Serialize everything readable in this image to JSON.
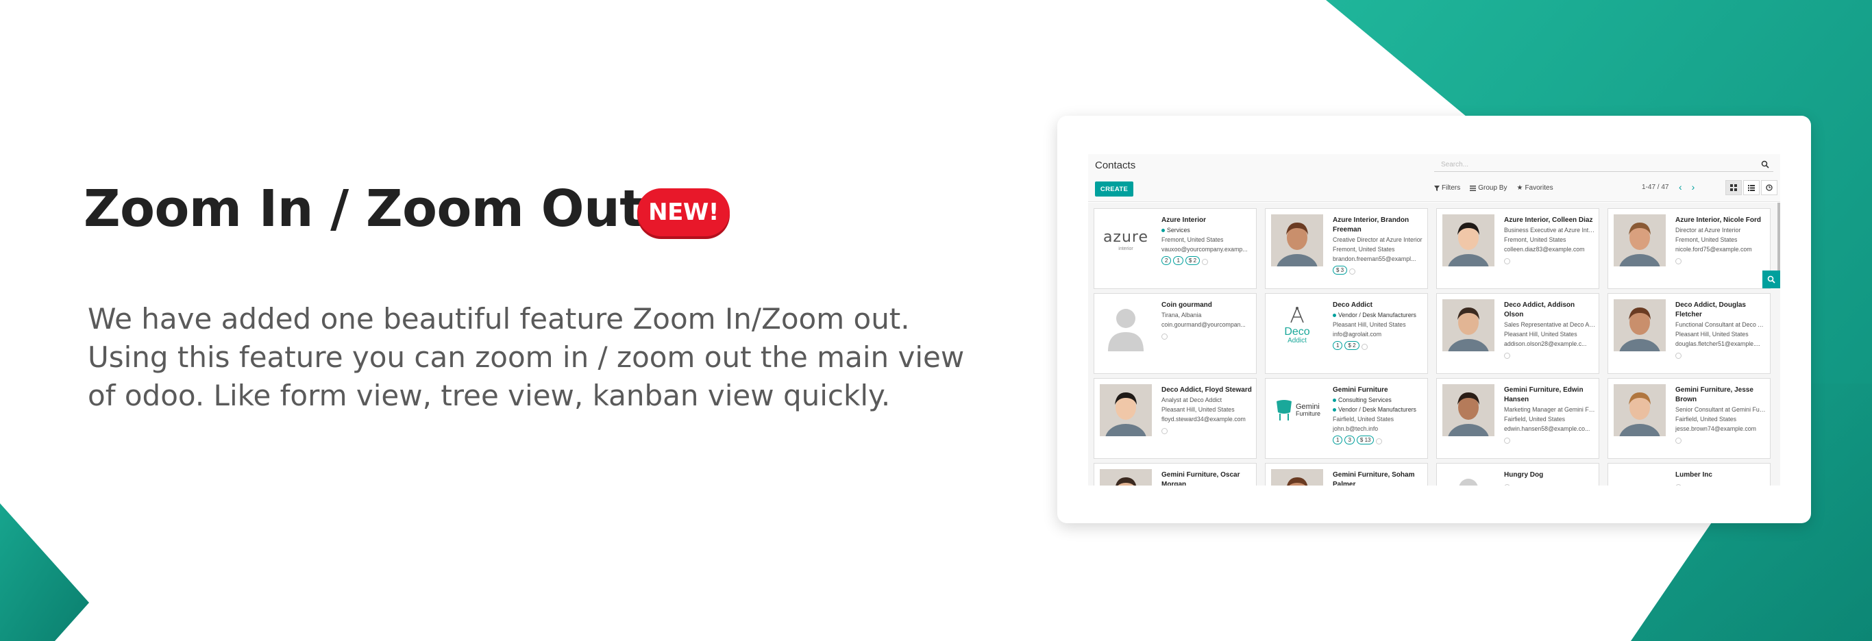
{
  "hero": {
    "title": "Zoom In / Zoom Out",
    "badge": "NEW!",
    "description_lines": [
      "We have added one beautiful feature Zoom In/Zoom out.",
      "Using this feature you can zoom in / zoom out the main view",
      "of odoo. Like form view, tree view, kanban view quickly."
    ]
  },
  "colors": {
    "accent": "#00a09d",
    "badge": "#e8182a",
    "bg_teal": "#1aa98f"
  },
  "app": {
    "breadcrumb": "Contacts",
    "search_placeholder": "Search...",
    "create_label": "CREATE",
    "filters_label": "Filters",
    "group_by_label": "Group By",
    "favorites_label": "Favorites",
    "pager": "1-47 / 47",
    "views": [
      "kanban-icon",
      "list-icon",
      "activity-icon"
    ]
  },
  "cards": [
    {
      "name": "Azure Interior",
      "lines": [],
      "tags": [
        "Services"
      ],
      "after_tags": [
        "Fremont, United States",
        "vauxoo@yourcompany.examp..."
      ],
      "pills": [
        "2",
        "1",
        "$ 2"
      ],
      "logo": "azure",
      "logo_text": "azure",
      "logo_sub": "interior"
    },
    {
      "name": "Azure Interior, Brandon Freeman",
      "lines": [
        "Creative Director at Azure Interior",
        "Fremont, United States",
        "brandon.freeman55@exampl..."
      ],
      "tags": [],
      "after_tags": [],
      "pills": [
        "$ 3"
      ],
      "logo": "person"
    },
    {
      "name": "Azure Interior, Colleen Diaz",
      "lines": [
        "Business Executive at Azure Inter...",
        "Fremont, United States",
        "colleen.diaz83@example.com"
      ],
      "tags": [],
      "after_tags": [],
      "pills": [],
      "logo": "person"
    },
    {
      "name": "Azure Interior, Nicole Ford",
      "lines": [
        "Director at Azure Interior",
        "Fremont, United States",
        "nicole.ford75@example.com"
      ],
      "tags": [],
      "after_tags": [],
      "pills": [],
      "logo": "person"
    },
    {
      "name": "Coin gourmand",
      "lines": [
        "Tirana, Albania",
        "coin.gourmand@yourcompan..."
      ],
      "tags": [],
      "after_tags": [],
      "pills": [],
      "logo": "silhouette"
    },
    {
      "name": "Deco Addict",
      "lines": [],
      "tags": [
        "Vendor / Desk Manufacturers"
      ],
      "after_tags": [
        "Pleasant Hill, United States",
        "info@agrolait.com"
      ],
      "pills": [
        "1",
        "$ 2"
      ],
      "logo": "deco",
      "logo_text": "Deco",
      "logo_sub": "Addict"
    },
    {
      "name": "Deco Addict, Addison Olson",
      "lines": [
        "Sales Representative at Deco Ad...",
        "Pleasant Hill, United States",
        "addison.olson28@example.c..."
      ],
      "tags": [],
      "after_tags": [],
      "pills": [],
      "logo": "person"
    },
    {
      "name": "Deco Addict, Douglas Fletcher",
      "lines": [
        "Functional Consultant at Deco Ad...",
        "Pleasant Hill, United States",
        "douglas.fletcher51@example...."
      ],
      "tags": [],
      "after_tags": [],
      "pills": [],
      "logo": "person"
    },
    {
      "name": "Deco Addict, Floyd Steward",
      "lines": [
        "Analyst at Deco Addict",
        "Pleasant Hill, United States",
        "floyd.steward34@example.com"
      ],
      "tags": [],
      "after_tags": [],
      "pills": [],
      "logo": "person"
    },
    {
      "name": "Gemini Furniture",
      "lines": [],
      "tags": [
        "Consulting Services",
        "Vendor / Desk Manufacturers"
      ],
      "after_tags": [
        "Fairfield, United States",
        "john.b@tech.info"
      ],
      "pills": [
        "1",
        "3",
        "$ 13"
      ],
      "logo": "gemini",
      "logo_text": "Gemini",
      "logo_sub": "Furniture"
    },
    {
      "name": "Gemini Furniture, Edwin Hansen",
      "lines": [
        "Marketing Manager at Gemini Fur...",
        "Fairfield, United States",
        "edwin.hansen58@example.co..."
      ],
      "tags": [],
      "after_tags": [],
      "pills": [],
      "logo": "person"
    },
    {
      "name": "Gemini Furniture, Jesse Brown",
      "lines": [
        "Senior Consultant at Gemini Furn...",
        "Fairfield, United States",
        "jesse.brown74@example.com"
      ],
      "tags": [],
      "after_tags": [],
      "pills": [],
      "logo": "person"
    },
    {
      "name": "Gemini Furniture, Oscar Morgan",
      "lines": [],
      "tags": [],
      "after_tags": [],
      "pills": [],
      "logo": "person"
    },
    {
      "name": "Gemini Furniture, Soham Palmer",
      "lines": [],
      "tags": [],
      "after_tags": [],
      "pills": [],
      "logo": "person"
    },
    {
      "name": "Hungry Dog",
      "lines": [],
      "tags": [],
      "after_tags": [],
      "pills": [],
      "logo": "silhouette"
    },
    {
      "name": "Lumber Inc",
      "lines": [],
      "tags": [],
      "after_tags": [],
      "pills": [],
      "logo": "none"
    }
  ]
}
